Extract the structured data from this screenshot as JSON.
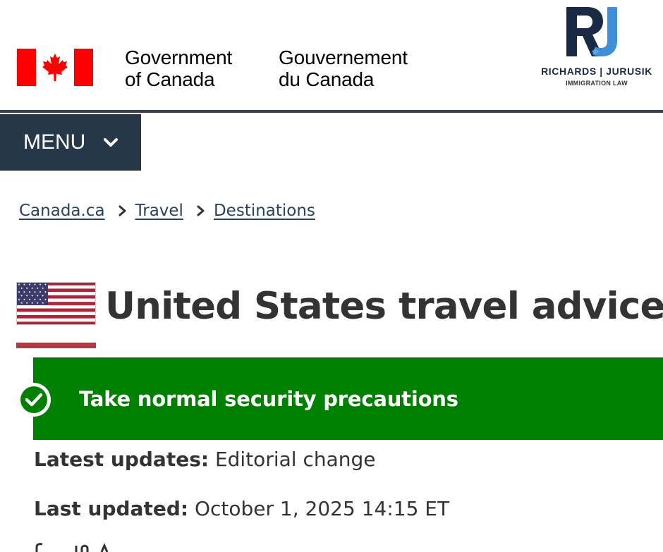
{
  "header": {
    "gov_en_line1": "Government",
    "gov_en_line2": "of Canada",
    "gov_fr_line1": "Gouvernement",
    "gov_fr_line2": "du Canada",
    "partner_logo": {
      "icon": "rj-monogram-icon",
      "name": "RICHARDS | JURUSIK",
      "subtitle": "IMMIGRATION LAW",
      "colors": {
        "navy": "#1b2a44",
        "blue": "#3f8fd8"
      }
    },
    "flag_icon": "canada-flag-icon"
  },
  "menu": {
    "label": "MENU",
    "icon": "chevron-down-icon"
  },
  "breadcrumb": {
    "items": [
      {
        "label": "Canada.ca"
      },
      {
        "label": "Travel"
      },
      {
        "label": "Destinations"
      }
    ],
    "separator_icon": "chevron-right-icon"
  },
  "page": {
    "title": "United States travel advice",
    "flag_icon": "united-states-flag-icon"
  },
  "advisory": {
    "label": "Take normal security precautions",
    "icon": "check-circle-icon",
    "color": "#008000"
  },
  "updates": {
    "latest_label": "Latest updates:",
    "latest_value": " Editorial change",
    "last_label": "Last updated:",
    "last_value": " October 1, 2025 14:15 ET"
  },
  "colors": {
    "menu_bg": "#26374a",
    "link": "#284162",
    "accent_rule": "#af3c43",
    "canada_red": "#ff0000"
  }
}
